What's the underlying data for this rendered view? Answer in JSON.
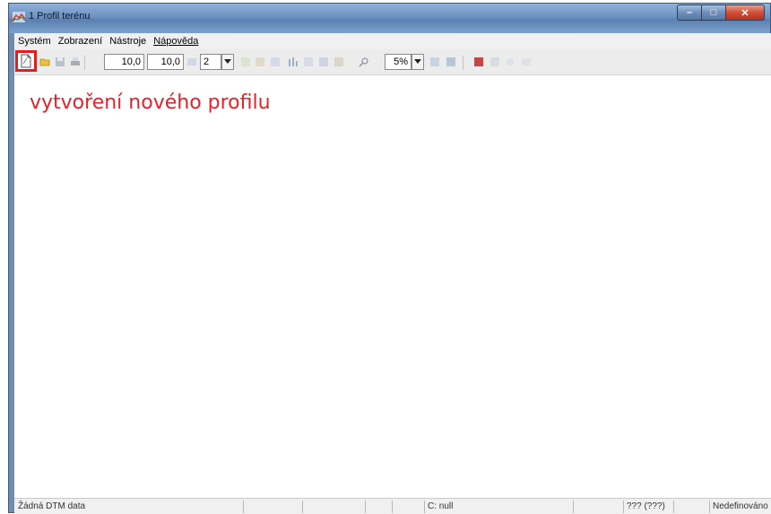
{
  "window": {
    "title": "1 Profil terénu",
    "min_symbol": "–",
    "max_symbol": "□",
    "close_symbol": "✕"
  },
  "menu": {
    "items": [
      {
        "label": "Systém"
      },
      {
        "label": "Zobrazení"
      },
      {
        "label": "Nástroje"
      },
      {
        "label": "Nápověda"
      }
    ]
  },
  "toolbar": {
    "field_x": "10,0",
    "field_y": "10,0",
    "combo_value": "2",
    "zoom_value": "5%",
    "icons": [
      "new-profile-icon",
      "open-folder-icon",
      "save-icon",
      "print-icon",
      "edit-icon",
      "chart-icon",
      "crosshair-icon",
      "grid-icon",
      "bar-chart-icon",
      "table-icon",
      "export-icon",
      "magnifier-icon",
      "list-icon",
      "layers-icon",
      "dtm-icon",
      "view-icon",
      "info-icon"
    ]
  },
  "annotation": {
    "text": "vytvoření nového profilu",
    "color": "#e8212a"
  },
  "status": {
    "dtm": "Žádná DTM data",
    "coord": "C: null",
    "units": "??? (???)",
    "state": "Nedefinováno"
  },
  "colors": {
    "accent_red": "#e02020",
    "titlebar": "#6f93c0"
  }
}
